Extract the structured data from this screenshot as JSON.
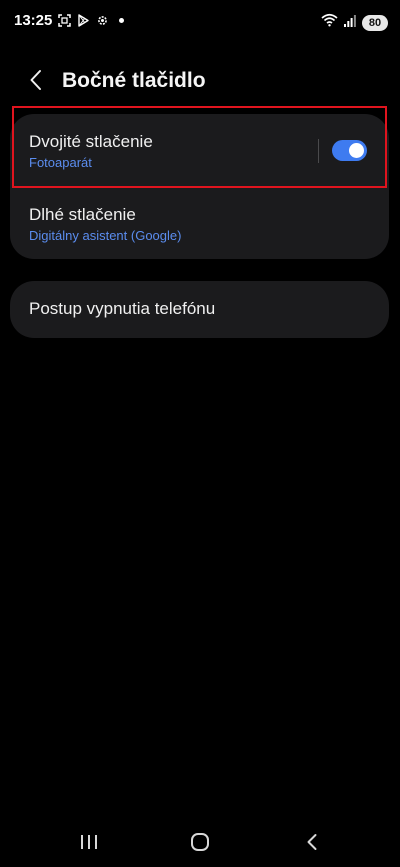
{
  "status_bar": {
    "time": "13:25",
    "battery": "80",
    "icons_left": [
      "screenshot-icon",
      "play-store-icon",
      "settings-gear-icon",
      "notification-dot"
    ],
    "icons_right": [
      "wifi-icon",
      "signal-icon",
      "battery-icon"
    ]
  },
  "header": {
    "title": "Bočné tlačidlo",
    "back_icon": "chevron-left-icon"
  },
  "settings": {
    "double_press": {
      "title": "Dvojité stlačenie",
      "subtitle": "Fotoaparát",
      "enabled": true
    },
    "long_press": {
      "title": "Dlhé stlačenie",
      "subtitle": "Digitálny asistent (Google)"
    },
    "power_off": {
      "title": "Postup vypnutia telefónu"
    }
  },
  "nav_bar": {
    "buttons": [
      "recents-icon",
      "home-icon",
      "back-icon"
    ]
  },
  "colors": {
    "background": "#000000",
    "card": "#1b1b1d",
    "accent": "#3e7bf0",
    "subtitle": "#5b8def",
    "highlight": "#e0141e"
  }
}
